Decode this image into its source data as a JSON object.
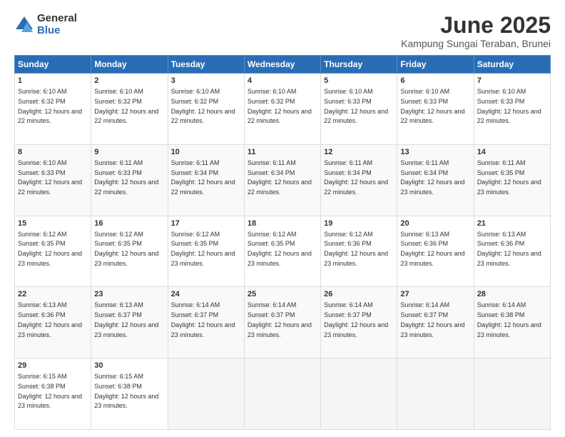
{
  "logo": {
    "general": "General",
    "blue": "Blue"
  },
  "header": {
    "month": "June 2025",
    "location": "Kampung Sungai Teraban, Brunei"
  },
  "weekdays": [
    "Sunday",
    "Monday",
    "Tuesday",
    "Wednesday",
    "Thursday",
    "Friday",
    "Saturday"
  ],
  "weeks": [
    [
      {
        "day": 1,
        "rise": "6:10 AM",
        "set": "6:32 PM",
        "hours": "12 hours and 22 minutes"
      },
      {
        "day": 2,
        "rise": "6:10 AM",
        "set": "6:32 PM",
        "hours": "12 hours and 22 minutes"
      },
      {
        "day": 3,
        "rise": "6:10 AM",
        "set": "6:32 PM",
        "hours": "12 hours and 22 minutes"
      },
      {
        "day": 4,
        "rise": "6:10 AM",
        "set": "6:32 PM",
        "hours": "12 hours and 22 minutes"
      },
      {
        "day": 5,
        "rise": "6:10 AM",
        "set": "6:33 PM",
        "hours": "12 hours and 22 minutes"
      },
      {
        "day": 6,
        "rise": "6:10 AM",
        "set": "6:33 PM",
        "hours": "12 hours and 22 minutes"
      },
      {
        "day": 7,
        "rise": "6:10 AM",
        "set": "6:33 PM",
        "hours": "12 hours and 22 minutes"
      }
    ],
    [
      {
        "day": 8,
        "rise": "6:10 AM",
        "set": "6:33 PM",
        "hours": "12 hours and 22 minutes"
      },
      {
        "day": 9,
        "rise": "6:11 AM",
        "set": "6:33 PM",
        "hours": "12 hours and 22 minutes"
      },
      {
        "day": 10,
        "rise": "6:11 AM",
        "set": "6:34 PM",
        "hours": "12 hours and 22 minutes"
      },
      {
        "day": 11,
        "rise": "6:11 AM",
        "set": "6:34 PM",
        "hours": "12 hours and 22 minutes"
      },
      {
        "day": 12,
        "rise": "6:11 AM",
        "set": "6:34 PM",
        "hours": "12 hours and 22 minutes"
      },
      {
        "day": 13,
        "rise": "6:11 AM",
        "set": "6:34 PM",
        "hours": "12 hours and 23 minutes"
      },
      {
        "day": 14,
        "rise": "6:11 AM",
        "set": "6:35 PM",
        "hours": "12 hours and 23 minutes"
      }
    ],
    [
      {
        "day": 15,
        "rise": "6:12 AM",
        "set": "6:35 PM",
        "hours": "12 hours and 23 minutes"
      },
      {
        "day": 16,
        "rise": "6:12 AM",
        "set": "6:35 PM",
        "hours": "12 hours and 23 minutes"
      },
      {
        "day": 17,
        "rise": "6:12 AM",
        "set": "6:35 PM",
        "hours": "12 hours and 23 minutes"
      },
      {
        "day": 18,
        "rise": "6:12 AM",
        "set": "6:35 PM",
        "hours": "12 hours and 23 minutes"
      },
      {
        "day": 19,
        "rise": "6:12 AM",
        "set": "6:36 PM",
        "hours": "12 hours and 23 minutes"
      },
      {
        "day": 20,
        "rise": "6:13 AM",
        "set": "6:36 PM",
        "hours": "12 hours and 23 minutes"
      },
      {
        "day": 21,
        "rise": "6:13 AM",
        "set": "6:36 PM",
        "hours": "12 hours and 23 minutes"
      }
    ],
    [
      {
        "day": 22,
        "rise": "6:13 AM",
        "set": "6:36 PM",
        "hours": "12 hours and 23 minutes"
      },
      {
        "day": 23,
        "rise": "6:13 AM",
        "set": "6:37 PM",
        "hours": "12 hours and 23 minutes"
      },
      {
        "day": 24,
        "rise": "6:14 AM",
        "set": "6:37 PM",
        "hours": "12 hours and 23 minutes"
      },
      {
        "day": 25,
        "rise": "6:14 AM",
        "set": "6:37 PM",
        "hours": "12 hours and 23 minutes"
      },
      {
        "day": 26,
        "rise": "6:14 AM",
        "set": "6:37 PM",
        "hours": "12 hours and 23 minutes"
      },
      {
        "day": 27,
        "rise": "6:14 AM",
        "set": "6:37 PM",
        "hours": "12 hours and 23 minutes"
      },
      {
        "day": 28,
        "rise": "6:14 AM",
        "set": "6:38 PM",
        "hours": "12 hours and 23 minutes"
      }
    ],
    [
      {
        "day": 29,
        "rise": "6:15 AM",
        "set": "6:38 PM",
        "hours": "12 hours and 23 minutes"
      },
      {
        "day": 30,
        "rise": "6:15 AM",
        "set": "6:38 PM",
        "hours": "12 hours and 23 minutes"
      },
      null,
      null,
      null,
      null,
      null
    ]
  ]
}
